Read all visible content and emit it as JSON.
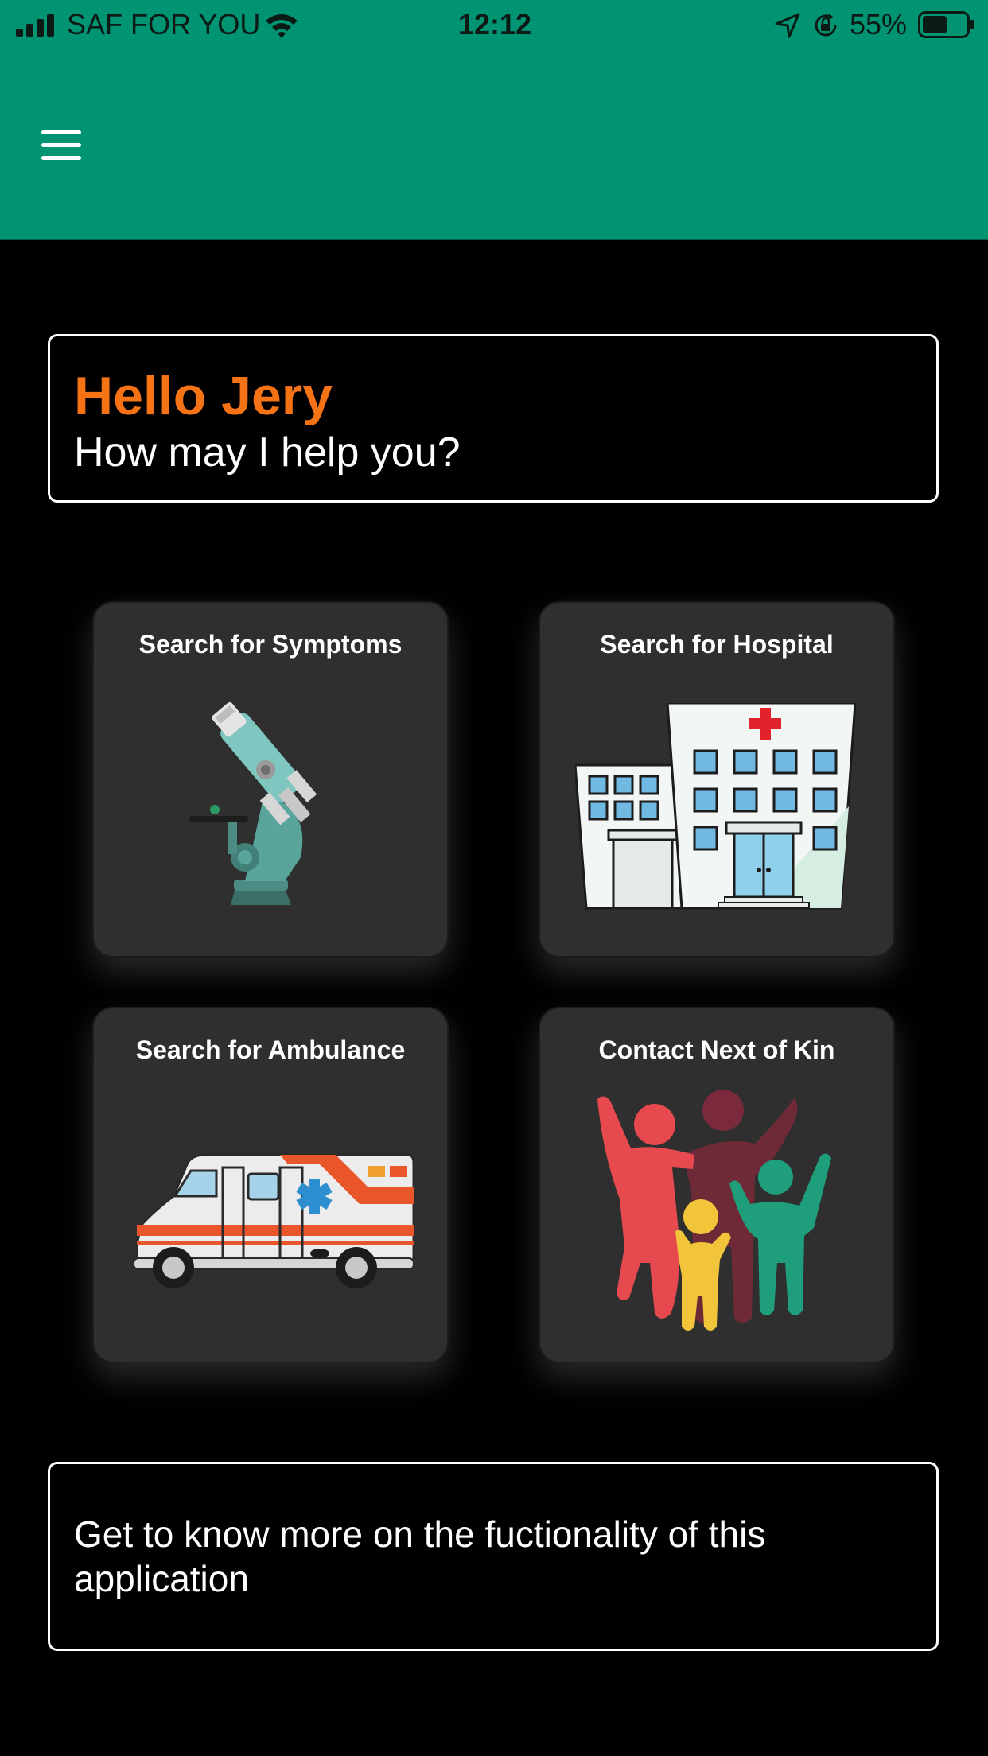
{
  "status_bar": {
    "carrier": "SAF FOR YOU",
    "time": "12:12",
    "battery": "55%",
    "signal_icon": "signal-bars-icon",
    "wifi_icon": "wifi-icon",
    "location_icon": "location-arrow-icon",
    "lock_icon": "rotation-lock-icon",
    "battery_icon": "battery-icon"
  },
  "header": {
    "menu_icon": "hamburger-menu-icon"
  },
  "greeting": {
    "hello": "Hello Jery",
    "prompt": "How may I help you?"
  },
  "cards": [
    {
      "label": "Search for Symptoms",
      "icon": "microscope-icon"
    },
    {
      "label": "Search for Hospital",
      "icon": "hospital-icon"
    },
    {
      "label": "Search for Ambulance",
      "icon": "ambulance-icon"
    },
    {
      "label": "Contact Next of Kin",
      "icon": "family-icon"
    }
  ],
  "info": {
    "text": "Get to know more on the fuctionality of this application"
  },
  "colors": {
    "header": "#009473",
    "accent": "#f57215",
    "card": "#2f2f2f",
    "background": "#000000"
  }
}
